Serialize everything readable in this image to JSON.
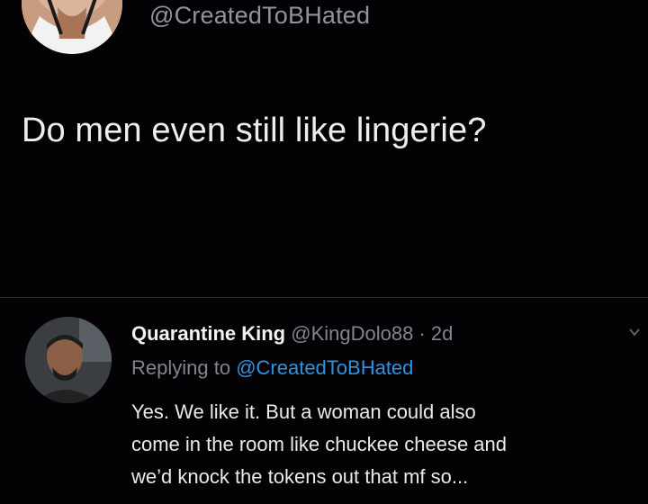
{
  "original_tweet": {
    "handle": "@CreatedToBHated",
    "text": "Do men even still like lingerie?"
  },
  "reply": {
    "display_name": "Quarantine King",
    "handle": "@KingDolo88",
    "separator": "·",
    "time": "2d",
    "replying_prefix": "Replying to ",
    "replying_mention": "@CreatedToBHated",
    "body_lines": [
      "Yes. We like it. But a woman could also",
      "come in the room like chuckee cheese and",
      "we’d knock the tokens out that mf so..."
    ]
  },
  "icons": {
    "more_menu": "chevron-down-icon"
  },
  "colors": {
    "background": "#050206",
    "primary_text": "#e7e9ea",
    "secondary_text": "#7f868c",
    "mention": "#2f93e0",
    "divider": "#2b2d31"
  }
}
